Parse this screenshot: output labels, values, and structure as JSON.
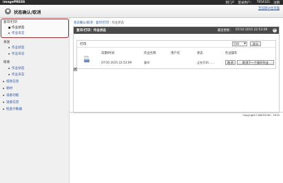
{
  "topbar": {
    "brand": "imagePRESS",
    "links": [
      "到门户",
      "登录用户：",
      "7654321",
      "注销"
    ]
  },
  "header": {
    "title": "状态确认/取消",
    "top_link": "至远程UI主页面"
  },
  "sidebar": {
    "sections": [
      {
        "label": "复印/打印",
        "items": [
          "作业状态",
          "作业日志"
        ]
      },
      {
        "label": "发送",
        "items": [
          "作业状态",
          "作业日志"
        ]
      },
      {
        "label": "接收",
        "items": [
          "作业状态",
          "作业日志"
        ]
      }
    ],
    "other_items": [
      "纸张信息",
      "耗材",
      "设备功能",
      "设备信息",
      "检查计数器"
    ]
  },
  "breadcrumb": {
    "root": "状态确认/取消",
    "middle": "复印/打印",
    "current": "作业状态",
    "sep": ":"
  },
  "panel": {
    "title": "复印/打印：作业状态",
    "last_updated_label": "最近更新：",
    "last_updated": "07/10 2015 22:53:09",
    "refresh_icon": "refresh-icon",
    "section_title": "打印",
    "filter_select": "打印",
    "display_button": "显示",
    "columns": [
      "日期/时间",
      "作业名称",
      "用户名",
      "状态",
      "作业操作"
    ],
    "row": {
      "datetime": "07/10 2015 22:53:09",
      "job_name": "复印",
      "user": "",
      "status": "正在打印……",
      "cancel_button": "取消",
      "cancel_next_button": "取消下一个复印作业"
    }
  },
  "footer": {
    "copyright": "Copyright CANON INC. 2015"
  }
}
